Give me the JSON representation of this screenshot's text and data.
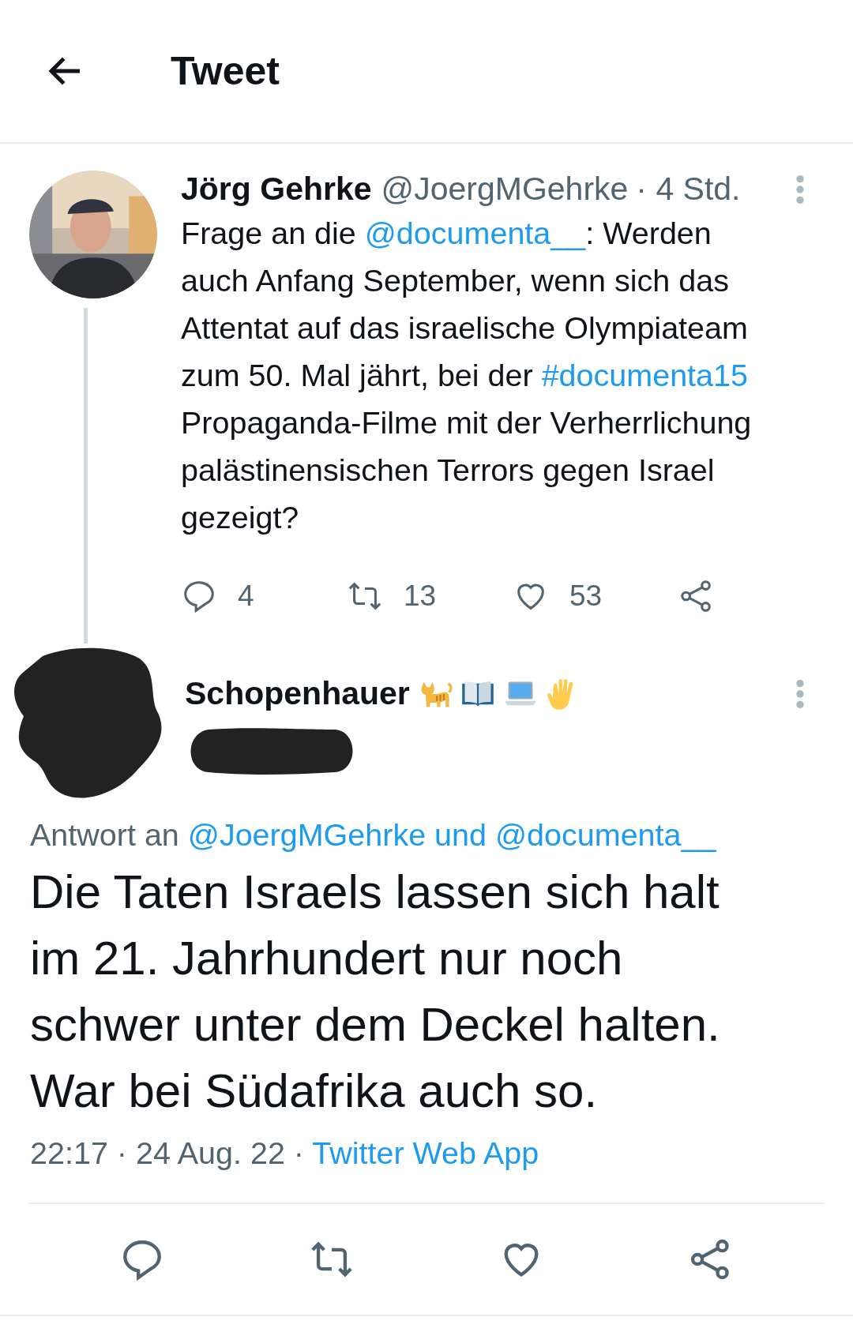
{
  "header": {
    "title": "Tweet"
  },
  "parent_tweet": {
    "name": "Jörg Gehrke",
    "handle": "@JoergMGehrke",
    "time": "· 4 Std.",
    "body": [
      {
        "kind": "text",
        "text": "Frage an die "
      },
      {
        "kind": "mention",
        "text": "@documenta__"
      },
      {
        "kind": "text",
        "text": ": Werden auch Anfang September, wenn sich das Attentat auf das israelische Olympiateam zum 50. Mal jährt, bei der "
      },
      {
        "kind": "hashtag",
        "text": "#documenta15"
      },
      {
        "kind": "text",
        "text": "  Propaganda-Filme mit der Verherrlichung palästinensischen Terrors gegen Israel gezeigt?"
      }
    ],
    "actions": [
      {
        "kind": "reply",
        "count": "4"
      },
      {
        "kind": "retweet",
        "count": "13"
      },
      {
        "kind": "like",
        "count": "53"
      },
      {
        "kind": "share"
      }
    ]
  },
  "main_tweet": {
    "name": "Schopenhauer",
    "name_icons": [
      {
        "kind": "cat"
      },
      {
        "kind": "book"
      },
      {
        "kind": "laptop"
      },
      {
        "kind": "hand"
      }
    ],
    "avatar": {
      "kind": "redacted"
    },
    "handle": {
      "kind": "redacted"
    },
    "reply_to": {
      "prefix": "Antwort an ",
      "targets": "@JoergMGehrke und @documenta__"
    },
    "text": "Die Taten Israels lassen sich halt im 21. Jahrhundert nur noch schwer unter dem Deckel halten. War bei Südafrika auch so.",
    "meta": "22:17 · 24 Aug. 22 · ",
    "source": "Twitter Web App",
    "actions": [
      {
        "kind": "reply"
      },
      {
        "kind": "retweet"
      },
      {
        "kind": "like"
      },
      {
        "kind": "share"
      }
    ]
  }
}
